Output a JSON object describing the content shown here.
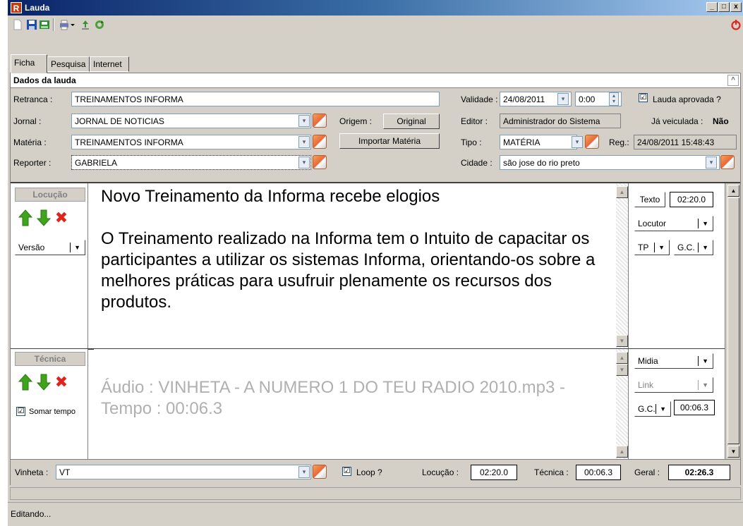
{
  "window": {
    "title": "Lauda",
    "app_icon_letter": "R",
    "minimize": "_",
    "maximize": "□",
    "close": "x"
  },
  "toolbar": {
    "icons": [
      "new-icon",
      "save-icon",
      "save-print-icon",
      "print-icon",
      "printer-dropdown-icon",
      "upload-icon",
      "refresh-icon"
    ],
    "power_icon": "power-icon",
    "colors": {
      "power": "#e0241b"
    }
  },
  "tabs": [
    {
      "label": "Ficha",
      "active": true
    },
    {
      "label": "Pesquisa",
      "active": false
    },
    {
      "label": "Internet",
      "active": false
    }
  ],
  "section": {
    "title": "Dados da lauda",
    "collapse_glyph": "^"
  },
  "form": {
    "retranca_label": "Retranca :",
    "retranca_value": "TREINAMENTOS INFORMA",
    "jornal_label": "Jornal :",
    "jornal_value": "JORNAL DE NOTICIAS",
    "materia_label": "Matéria :",
    "materia_value": "TREINAMENTOS INFORMA",
    "reporter_label": "Reporter :",
    "reporter_value": "GABRIELA",
    "origem_label": "Origem :",
    "origem_button": "Original",
    "importar_button": "Importar Matéria",
    "validade_label": "Validade :",
    "validade_date": "24/08/2011",
    "validade_time": "0:00",
    "editor_label": "Editor :",
    "editor_value": "Administrador do Sistema",
    "tipo_label": "Tipo :",
    "tipo_value": "MATÉRIA",
    "reg_label": "Reg.:",
    "reg_value": "24/08/2011 15:48:43",
    "cidade_label": "Cidade :",
    "cidade_value": "são jose do rio preto",
    "lauda_aprovada_label": "Lauda aprovada ?",
    "lauda_aprovada_checked": "☑",
    "ja_veiculada_label": "Já veiculada :",
    "ja_veiculada_value": "Não"
  },
  "locucao": {
    "header": "Locução",
    "versao_label": "Versão",
    "text_line1": "Novo Treinamento da Informa recebe elogios",
    "text_line2": "O Treinamento realizado na Informa tem o Intuito de capacitar os participantes a utilizar os sistemas Informa, orientando-os sobre a melhores práticas para usufruir plenamente os recursos dos produtos.",
    "texto_button": "Texto",
    "texto_time": "02:20.0",
    "locutor_label": "Locutor",
    "tp_label": "TP",
    "gc_label": "G.C.",
    "colors": {
      "up": "#3fa31c",
      "down": "#3fa31c",
      "delete": "#e0241b"
    }
  },
  "tecnica": {
    "header": "Técnica",
    "somar_tempo_label": "Somar tempo",
    "somar_tempo_checked": "☑",
    "text": "Áudio : VINHETA - A NUMERO 1 DO TEU RADIO 2010.mp3 - Tempo : 00:06.3",
    "midia_label": "Midia",
    "link_label": "Link",
    "gc_label": "G.C.",
    "gc_time": "00:06.3"
  },
  "bottom": {
    "vinheta_label": "Vinheta :",
    "vinheta_value": "VT",
    "loop_label": "Loop ?",
    "loop_checked": "☑",
    "locucao_label": "Locução :",
    "locucao_time": "02:20.0",
    "tecnica_label": "Técnica :",
    "tecnica_time": "00:06.3",
    "geral_label": "Geral :",
    "geral_time": "02:26.3"
  },
  "status": {
    "text": "Editando..."
  }
}
